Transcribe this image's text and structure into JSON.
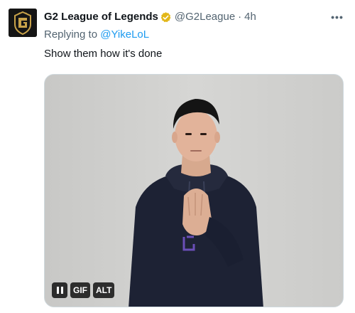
{
  "tweet": {
    "display_name": "G2 League of Legends",
    "handle": "@G2League",
    "separator": "·",
    "time": "4h",
    "replying_prefix": "Replying to",
    "replying_to": "@YikeLoL",
    "text": "Show them how it's done",
    "more_label": "•••"
  },
  "media": {
    "type": "gif",
    "gif_badge": "GIF",
    "alt_badge": "ALT",
    "pause_icon": "pause-icon"
  },
  "colors": {
    "link": "#1d9bf0",
    "secondary_text": "#536471",
    "verified_badge": "#e2b719",
    "background": "#ffffff"
  },
  "icons": {
    "avatar": "g2-logo",
    "verified": "verified-badge-icon",
    "more": "more-icon"
  }
}
